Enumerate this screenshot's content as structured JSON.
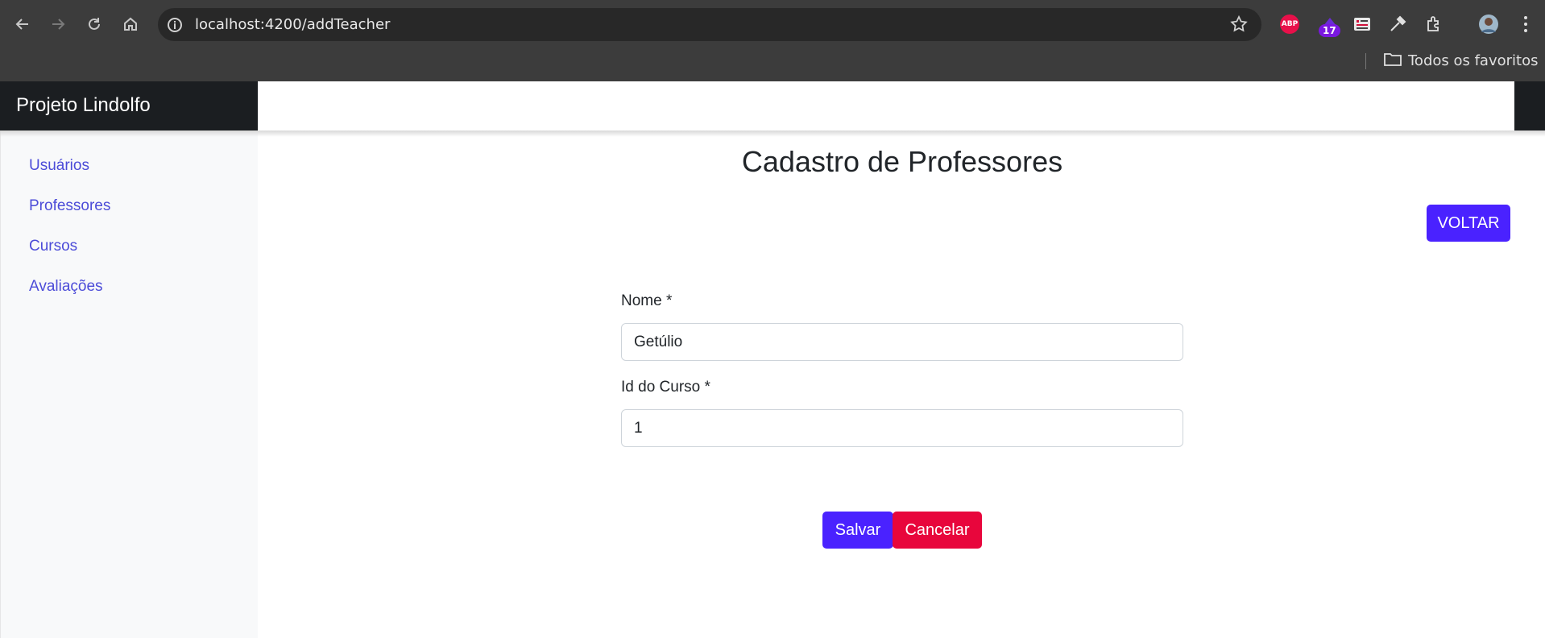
{
  "browser": {
    "url": "localhost:4200/addTeacher",
    "extension_badge": "17",
    "abp_label": "ABP",
    "bookmarks_label": "Todos os favoritos"
  },
  "app": {
    "brand": "Projeto Lindolfo"
  },
  "sidebar": {
    "items": [
      {
        "label": "Usuários"
      },
      {
        "label": "Professores"
      },
      {
        "label": "Cursos"
      },
      {
        "label": "Avaliações"
      }
    ]
  },
  "page": {
    "title": "Cadastro de Professores",
    "back_label": "VOLTAR"
  },
  "form": {
    "name_label": "Nome *",
    "name_value": "Getúlio",
    "course_label": "Id do Curso *",
    "course_value": "1",
    "save_label": "Salvar",
    "cancel_label": "Cancelar"
  },
  "colors": {
    "primary": "#4a22ff",
    "danger": "#e8063c",
    "link": "#4c4cd8",
    "brand_bg": "#1b1e21"
  }
}
